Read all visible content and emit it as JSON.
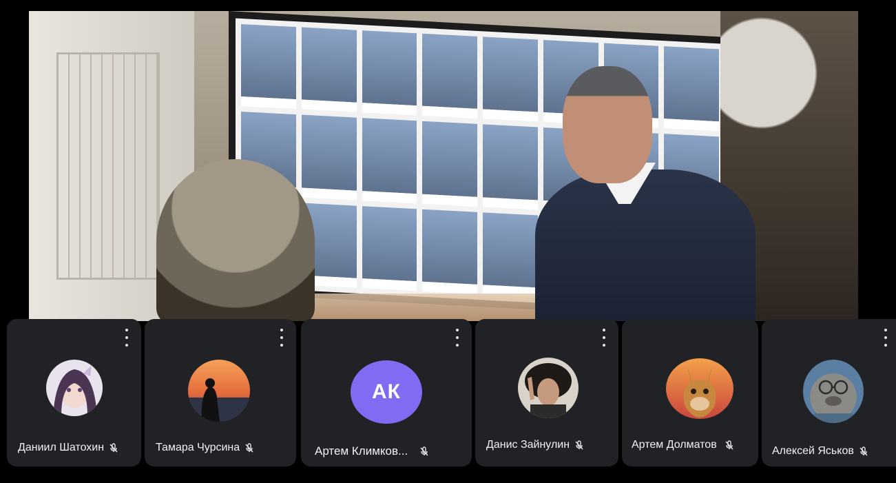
{
  "participants": [
    {
      "name": "Даниил Шатохин",
      "avatar_type": "image",
      "avatar_desc": "anime-girl-avatar",
      "muted": true
    },
    {
      "name": "Тамара Чурсина",
      "avatar_type": "image",
      "avatar_desc": "sunset-photo-avatar",
      "muted": true
    },
    {
      "name": "Артем Климков...",
      "avatar_type": "initials",
      "initials": "АК",
      "avatar_color": "#7f6cf2",
      "muted": true
    },
    {
      "name": "Данис Зайнулин",
      "avatar_type": "image",
      "avatar_desc": "curly-hair-photo-avatar",
      "muted": true
    },
    {
      "name": "Артем Долматов",
      "avatar_type": "image",
      "avatar_desc": "llama-avatar",
      "muted": true
    },
    {
      "name": "Алексей Яськов",
      "avatar_type": "image",
      "avatar_desc": "seal-glasses-avatar",
      "muted": true
    }
  ],
  "icons": {
    "more": "more-vertical-icon",
    "mic": "mic-off-icon"
  },
  "colors": {
    "tile_bg": "#212226",
    "text": "#f2f2f4",
    "accent": "#7f6cf2"
  }
}
